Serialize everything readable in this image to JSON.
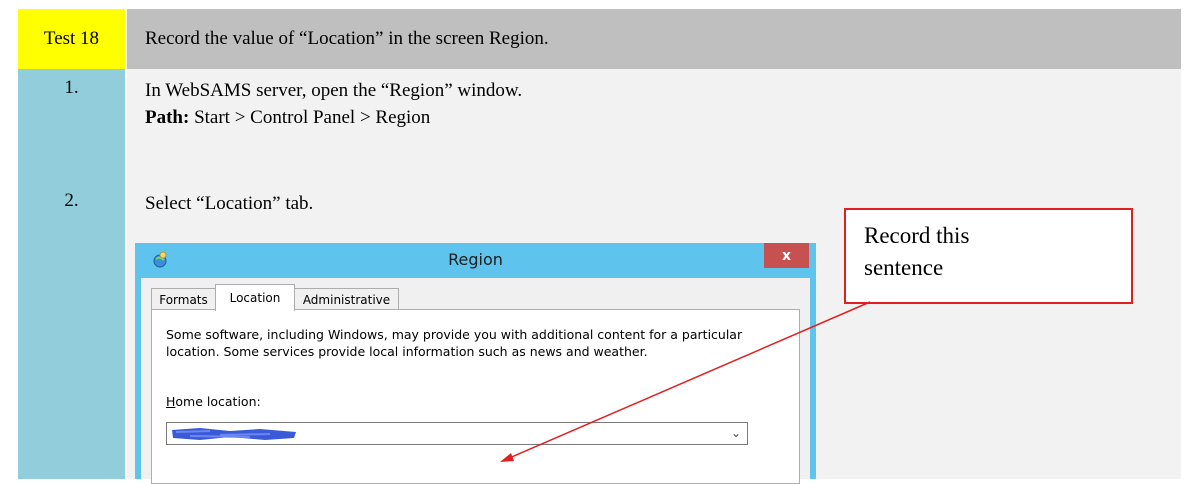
{
  "header": {
    "test_id": "Test 18",
    "description": "Record the value of “Location” in the screen Region."
  },
  "steps": [
    {
      "number": "1.",
      "line1": "In WebSAMS server, open the “Region” window.",
      "path_label": "Path:",
      "path_value": "Start > Control Panel > Region"
    },
    {
      "number": "2.",
      "line1": "Select “Location” tab."
    }
  ],
  "dialog": {
    "title": "Region",
    "close_label": "x",
    "tabs": [
      {
        "label": "Formats",
        "active": false
      },
      {
        "label": "Location",
        "active": true
      },
      {
        "label": "Administrative",
        "active": false
      }
    ],
    "info_text": "Some software, including Windows, may provide you with additional content for a particular location. Some services provide local information such as news and weather.",
    "home_location_label_first": "H",
    "home_location_label_rest": "ome location:",
    "home_location_value": "",
    "dropdown_icon": "chevron-down-icon"
  },
  "annotation": {
    "line1": "Record this",
    "line2": "sentence",
    "color": "#e02020"
  },
  "colors": {
    "header_number_bg": "#ffff00",
    "header_desc_bg": "#bfbfbf",
    "step_number_col_bg": "#92cddc",
    "step_content_bg": "#f2f2f2",
    "dialog_frame": "#5fc4ed",
    "close_button": "#c75050"
  }
}
